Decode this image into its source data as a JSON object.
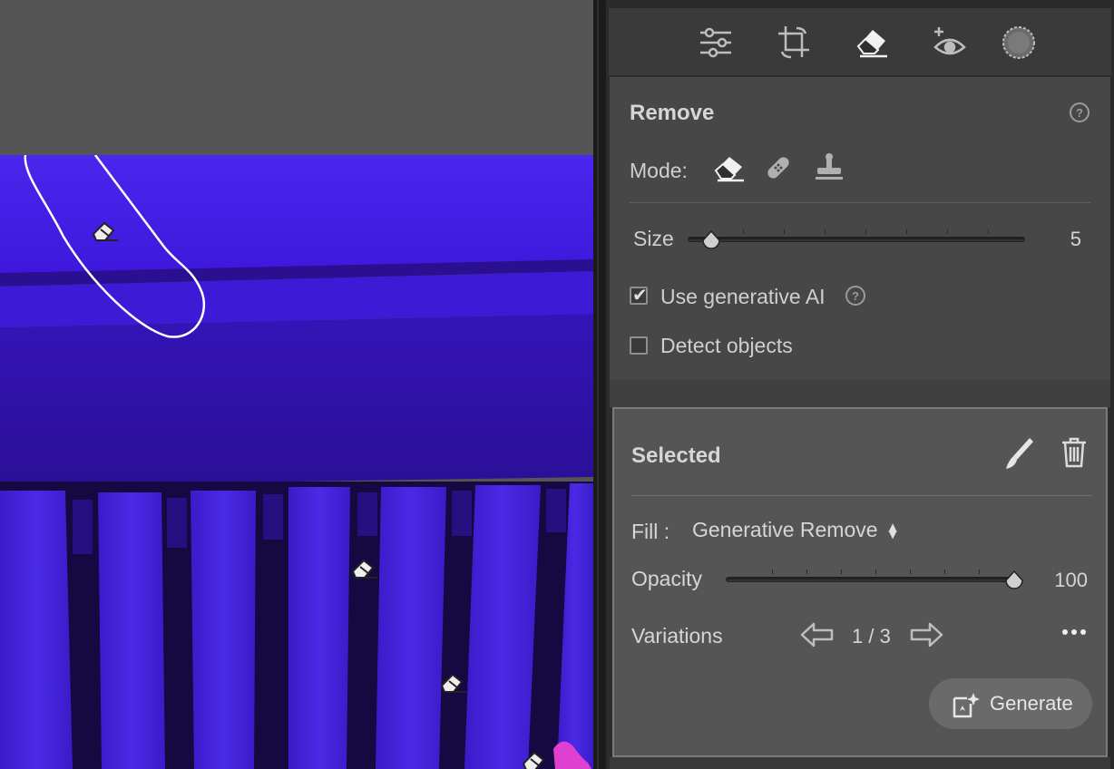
{
  "toolbar": {
    "tools": [
      {
        "icon": "edit-sliders-icon"
      },
      {
        "icon": "crop-icon"
      },
      {
        "icon": "remove-eraser-icon",
        "active": true
      },
      {
        "icon": "red-eye-icon"
      },
      {
        "icon": "masking-icon"
      }
    ]
  },
  "remove": {
    "title": "Remove",
    "mode_label": "Mode:",
    "modes": [
      "eraser-icon",
      "bandage-heal-icon",
      "clone-stamp-icon"
    ],
    "size_label": "Size",
    "size_value": "5",
    "size_level": 0.07,
    "use_generative_ai_label": "Use generative AI",
    "use_generative_ai_checked": true,
    "detect_objects_label": "Detect objects",
    "detect_objects_checked": false
  },
  "selected": {
    "title": "Selected",
    "fill_label": "Fill :",
    "fill_value": "Generative Remove",
    "opacity_label": "Opacity",
    "opacity_value": "100",
    "opacity_level": 1.0,
    "variations_label": "Variations",
    "variations_value": "1 / 3",
    "generate_label": "Generate"
  },
  "colors": {
    "photo_tint": "#3f17e0",
    "panel_bg": "#474747",
    "selected_bg": "#555555",
    "canvas_bg": "#555555"
  }
}
